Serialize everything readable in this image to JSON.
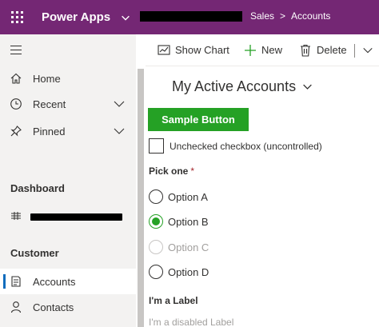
{
  "topbar": {
    "app_name": "Power Apps",
    "breadcrumb": [
      "Sales",
      "Accounts"
    ],
    "breadcrumb_sep": ">"
  },
  "sidebar": {
    "items": [
      {
        "label": "Home",
        "icon": "home-icon"
      },
      {
        "label": "Recent",
        "icon": "clock-icon"
      },
      {
        "label": "Pinned",
        "icon": "pin-icon"
      }
    ],
    "section_dashboard": "Dashboard",
    "section_customer": "Customer",
    "customer_items": [
      {
        "label": "Accounts",
        "icon": "accounts-icon",
        "active": true
      },
      {
        "label": "Contacts",
        "icon": "person-icon"
      }
    ]
  },
  "commands": {
    "show_chart": "Show Chart",
    "new": "New",
    "delete": "Delete"
  },
  "main": {
    "view_title": "My Active Accounts",
    "sample_button": "Sample Button",
    "checkbox_label": "Unchecked checkbox (uncontrolled)",
    "pick_label": "Pick one",
    "required_mark": "*",
    "options": [
      {
        "label": "Option A",
        "state": "unchecked"
      },
      {
        "label": "Option B",
        "state": "checked"
      },
      {
        "label": "Option C",
        "state": "disabled"
      },
      {
        "label": "Option D",
        "state": "unchecked"
      }
    ],
    "label": "I'm a Label",
    "disabled_label": "I'm a disabled Label"
  },
  "colors": {
    "topbar": "#742774",
    "accent_green": "#25a125",
    "active_blue": "#0f6cbd"
  }
}
